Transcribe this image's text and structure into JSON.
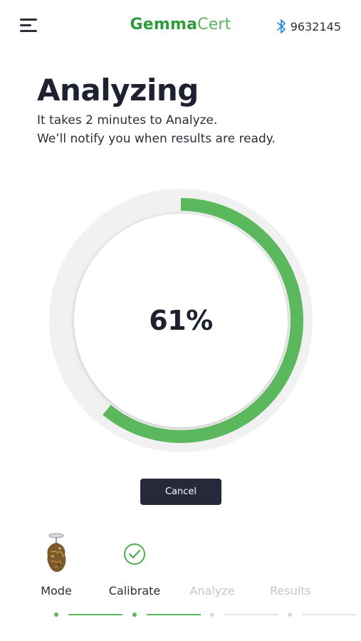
{
  "header": {
    "menu_icon": "hamburger-menu-icon",
    "logo_part1": "Gemma",
    "logo_part2": "Cert",
    "bluetooth_icon": "bluetooth-icon",
    "device_id": "9632145"
  },
  "main": {
    "title": "Analyzing",
    "subtitle_line1": "It takes 2 minutes to Analyze.",
    "subtitle_line2": "We’ll notify you when results are ready.",
    "progress_percent": 61,
    "progress_text": "61%",
    "cancel_label": "Cancel"
  },
  "steps": [
    {
      "label": "Mode",
      "state": "done",
      "icon": "sample-bud-icon"
    },
    {
      "label": "Calibrate",
      "state": "done",
      "icon": "check-circle-icon"
    },
    {
      "label": "Analyze",
      "state": "pending"
    },
    {
      "label": "Results",
      "state": "pending"
    }
  ],
  "colors": {
    "brand_green": "#2e9c3e",
    "progress_green": "#5cb85c",
    "ring_track": "#efefef",
    "button_dark": "#25293a",
    "inactive_gray": "#c2c4c8"
  }
}
